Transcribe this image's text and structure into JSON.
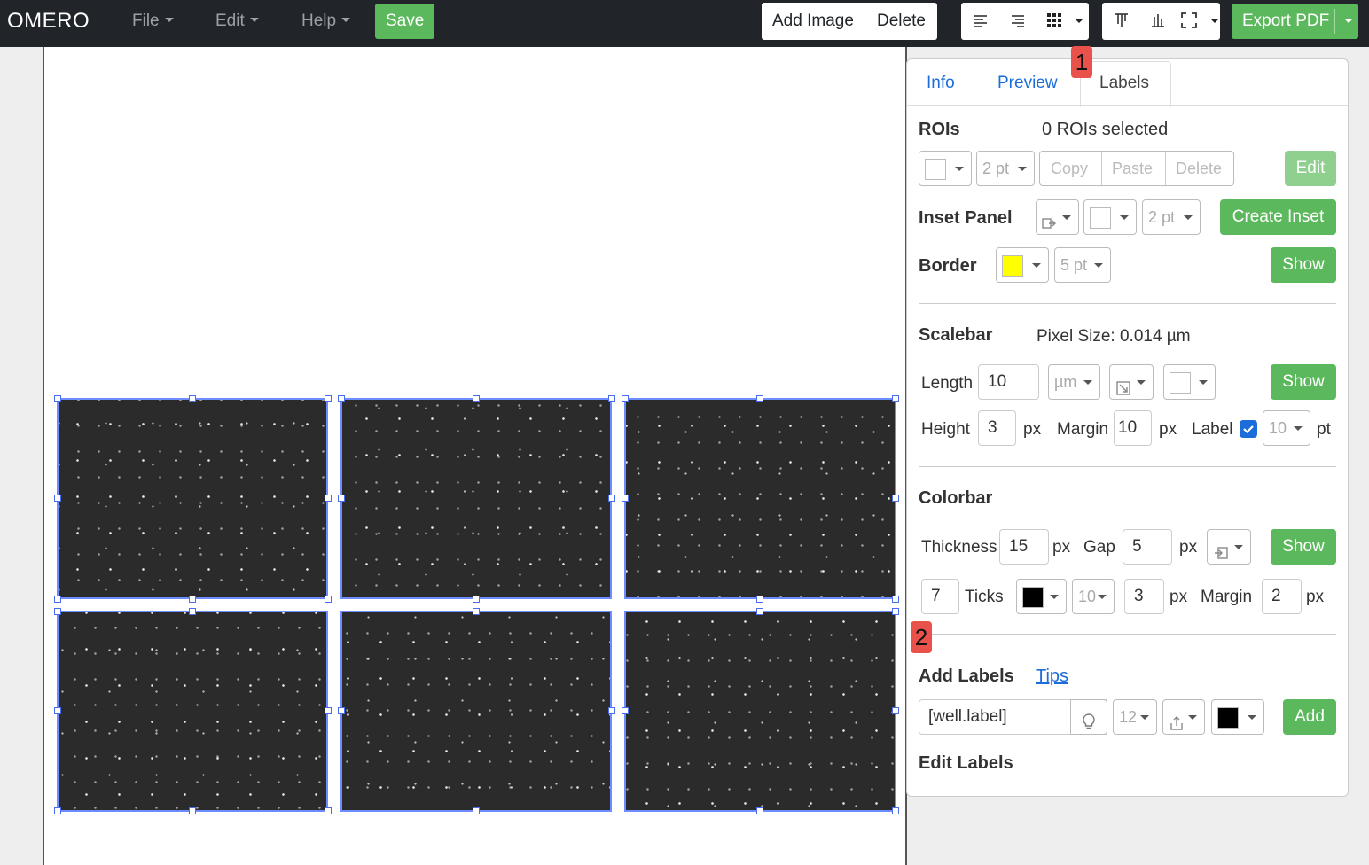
{
  "navbar": {
    "brand": "OMERO",
    "menus": [
      "File",
      "Edit",
      "Help"
    ],
    "save": "Save",
    "add_image": "Add Image",
    "delete": "Delete",
    "export": "Export PDF"
  },
  "tabs": [
    "Info",
    "Preview",
    "Labels"
  ],
  "rois": {
    "title": "ROIs",
    "selected": "0 ROIs selected",
    "width": "2 pt",
    "copy": "Copy",
    "paste": "Paste",
    "delete": "Delete",
    "edit": "Edit"
  },
  "inset": {
    "title": "Inset Panel",
    "width": "2 pt",
    "create": "Create Inset"
  },
  "border": {
    "title": "Border",
    "width": "5 pt",
    "show": "Show",
    "color": "#ffff00"
  },
  "scalebar": {
    "title": "Scalebar",
    "pixel_size": "Pixel Size: 0.014 µm",
    "length_label": "Length",
    "length": "10",
    "unit": "µm",
    "show": "Show",
    "height_label": "Height",
    "height": "3",
    "px": "px",
    "margin_label": "Margin",
    "margin": "10",
    "label_label": "Label",
    "font": "10",
    "pt": "pt"
  },
  "colorbar": {
    "title": "Colorbar",
    "thickness_label": "Thickness",
    "thickness": "15",
    "gap_label": "Gap",
    "gap": "5",
    "px": "px",
    "show": "Show",
    "ticks_value": "7",
    "ticks_label": "Ticks",
    "font": "10",
    "tick_len": "3",
    "margin_label": "Margin",
    "margin": "2",
    "color": "#000000"
  },
  "add_labels": {
    "title": "Add Labels",
    "tips": "Tips",
    "text": "[well.label]",
    "size": "12",
    "add": "Add",
    "color": "#000000"
  },
  "edit_labels": {
    "title": "Edit Labels"
  },
  "badges": [
    "1",
    "2"
  ]
}
